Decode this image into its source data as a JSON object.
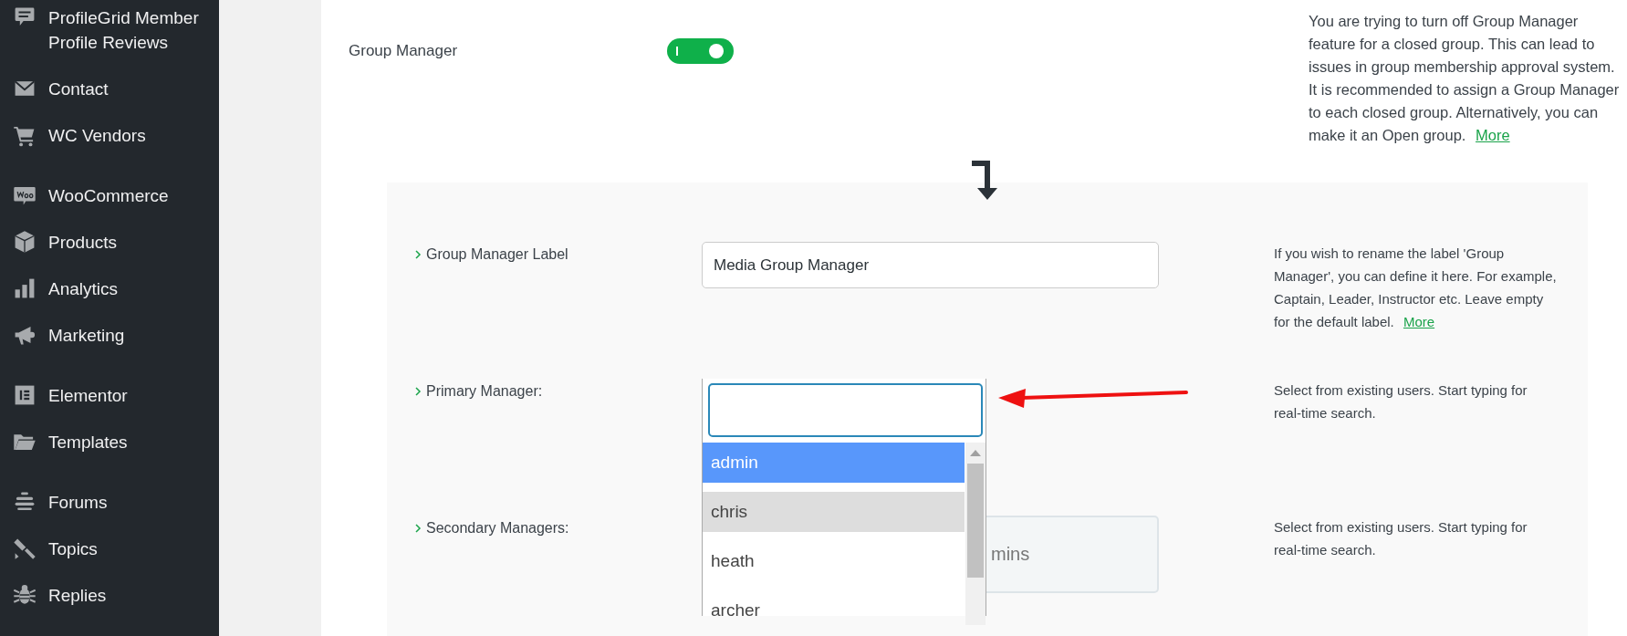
{
  "sidebar": {
    "groups": [
      {
        "items": [
          {
            "label": "ProfileGrid Member Profile Reviews"
          },
          {
            "label": "Contact"
          },
          {
            "label": "WC Vendors"
          }
        ]
      },
      {
        "items": [
          {
            "label": "WooCommerce"
          },
          {
            "label": "Products"
          },
          {
            "label": "Analytics"
          },
          {
            "label": "Marketing"
          }
        ]
      },
      {
        "items": [
          {
            "label": "Elementor"
          },
          {
            "label": "Templates"
          }
        ]
      },
      {
        "items": [
          {
            "label": "Forums"
          },
          {
            "label": "Topics"
          },
          {
            "label": "Replies"
          }
        ]
      }
    ]
  },
  "group_manager": {
    "label": "Group Manager",
    "on": true,
    "help": "You are trying to turn off Group Manager feature for a closed group. This can lead to issues in group membership approval system. It is recommended to assign a Group Manager to each closed group. Alternatively, you can make it an Open group.",
    "help_link": "More"
  },
  "panel": {
    "rows": [
      {
        "kind": "text",
        "label": "Group Manager Label",
        "value": "Media Group Manager",
        "help": "If you wish to rename the label 'Group Manager', you can define it here. For example, Captain, Leader, Instructor etc. Leave empty for the default label.",
        "help_link": "More"
      },
      {
        "kind": "user-select",
        "label": "Primary Manager:",
        "help": "Select from existing users. Start typing for real-time search.",
        "options": [
          {
            "label": "admin",
            "highlighted": true,
            "selected": false
          },
          {
            "label": "chris",
            "highlighted": false,
            "selected": true
          },
          {
            "label": "heath",
            "highlighted": false,
            "selected": false
          },
          {
            "label": "archer",
            "highlighted": false,
            "selected": false
          }
        ]
      },
      {
        "kind": "multi-select",
        "label": "Secondary Managers:",
        "placeholder": "mins",
        "help": "Select from existing users. Start typing for real-time search."
      }
    ]
  }
}
